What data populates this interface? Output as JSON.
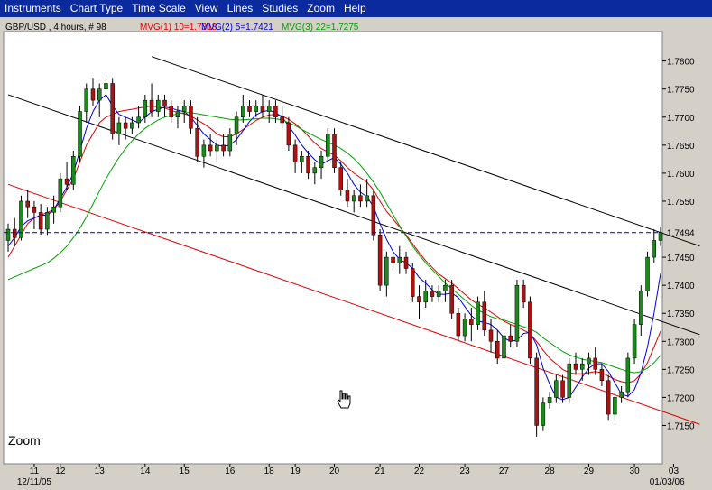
{
  "menu": [
    "Instruments",
    "Chart Type",
    "Time Scale",
    "View",
    "Lines",
    "Studies",
    "Zoom",
    "Help"
  ],
  "chart_header": {
    "instrument": "GBP/USD , 4 hours, # 98",
    "mvg1": "MVG(1) 10=1.7318",
    "mvg2": "MVG(2) 5=1.7421",
    "mvg3": "MVG(3) 22=1.7275"
  },
  "zoom_label": "Zoom",
  "current_price_label": "1.7494",
  "colors": {
    "menubar": "#0a2a9e",
    "up_candle": "#1a8a1a",
    "down_candle": "#b01010",
    "mvg1": "#e00000",
    "mvg2": "#0000dd",
    "mvg3": "#00a000",
    "price_line": "#0000aa"
  },
  "chart_data": {
    "type": "candlestick",
    "title": "GBP/USD , 4 hours, # 98",
    "ylim": [
      1.7125,
      1.783
    ],
    "grid": false,
    "y_ticks": [
      "1.7800",
      "1.7750",
      "1.7700",
      "1.7650",
      "1.7600",
      "1.7550",
      "1.7500",
      "1.7450",
      "1.7400",
      "1.7350",
      "1.7300",
      "1.7250",
      "1.7200",
      "1.7150"
    ],
    "x_ticks": [
      {
        "label": "11",
        "index": 4
      },
      {
        "label": "12",
        "index": 8
      },
      {
        "label": "13",
        "index": 14
      },
      {
        "label": "14",
        "index": 21
      },
      {
        "label": "15",
        "index": 27
      },
      {
        "label": "16",
        "index": 34
      },
      {
        "label": "18",
        "index": 40
      },
      {
        "label": "19",
        "index": 44
      },
      {
        "label": "20",
        "index": 50
      },
      {
        "label": "21",
        "index": 57
      },
      {
        "label": "22",
        "index": 63
      },
      {
        "label": "23",
        "index": 70
      },
      {
        "label": "27",
        "index": 76
      },
      {
        "label": "28",
        "index": 83
      },
      {
        "label": "29",
        "index": 89
      },
      {
        "label": "30",
        "index": 96
      },
      {
        "label": "03",
        "index": 102
      }
    ],
    "x_sublabels": [
      {
        "label": "12/11/05",
        "index": 4
      },
      {
        "label": "01/03/06",
        "index": 101
      }
    ],
    "current_price": 1.7494,
    "candles": [
      [
        1.748,
        1.751,
        1.746,
        1.75
      ],
      [
        1.75,
        1.752,
        1.747,
        1.7485
      ],
      [
        1.7485,
        1.756,
        1.748,
        1.755
      ],
      [
        1.755,
        1.757,
        1.752,
        1.754
      ],
      [
        1.754,
        1.755,
        1.75,
        1.753
      ],
      [
        1.753,
        1.7545,
        1.749,
        1.75
      ],
      [
        1.75,
        1.754,
        1.749,
        1.753
      ],
      [
        1.753,
        1.756,
        1.751,
        1.754
      ],
      [
        1.754,
        1.76,
        1.753,
        1.759
      ],
      [
        1.759,
        1.762,
        1.757,
        1.758
      ],
      [
        1.758,
        1.764,
        1.757,
        1.763
      ],
      [
        1.763,
        1.772,
        1.762,
        1.771
      ],
      [
        1.771,
        1.776,
        1.769,
        1.775
      ],
      [
        1.775,
        1.777,
        1.772,
        1.773
      ],
      [
        1.773,
        1.776,
        1.77,
        1.775
      ],
      [
        1.775,
        1.777,
        1.773,
        1.776
      ],
      [
        1.776,
        1.777,
        1.766,
        1.767
      ],
      [
        1.767,
        1.77,
        1.765,
        1.769
      ],
      [
        1.769,
        1.77,
        1.766,
        1.768
      ],
      [
        1.768,
        1.77,
        1.767,
        1.769
      ],
      [
        1.769,
        1.772,
        1.768,
        1.77
      ],
      [
        1.77,
        1.774,
        1.769,
        1.773
      ],
      [
        1.773,
        1.776,
        1.77,
        1.771
      ],
      [
        1.771,
        1.774,
        1.77,
        1.773
      ],
      [
        1.773,
        1.774,
        1.77,
        1.772
      ],
      [
        1.772,
        1.773,
        1.769,
        1.77
      ],
      [
        1.77,
        1.772,
        1.768,
        1.771
      ],
      [
        1.771,
        1.773,
        1.769,
        1.772
      ],
      [
        1.772,
        1.773,
        1.767,
        1.768
      ],
      [
        1.768,
        1.77,
        1.762,
        1.763
      ],
      [
        1.763,
        1.766,
        1.761,
        1.765
      ],
      [
        1.765,
        1.767,
        1.763,
        1.764
      ],
      [
        1.764,
        1.766,
        1.762,
        1.765
      ],
      [
        1.765,
        1.767,
        1.763,
        1.764
      ],
      [
        1.764,
        1.768,
        1.763,
        1.767
      ],
      [
        1.767,
        1.771,
        1.765,
        1.77
      ],
      [
        1.77,
        1.774,
        1.769,
        1.772
      ],
      [
        1.772,
        1.773,
        1.77,
        1.771
      ],
      [
        1.771,
        1.773,
        1.77,
        1.772
      ],
      [
        1.772,
        1.774,
        1.77,
        1.771
      ],
      [
        1.771,
        1.773,
        1.769,
        1.772
      ],
      [
        1.772,
        1.773,
        1.769,
        1.77
      ],
      [
        1.77,
        1.772,
        1.768,
        1.769
      ],
      [
        1.769,
        1.77,
        1.764,
        1.765
      ],
      [
        1.765,
        1.766,
        1.76,
        1.762
      ],
      [
        1.762,
        1.764,
        1.76,
        1.763
      ],
      [
        1.763,
        1.764,
        1.759,
        1.76
      ],
      [
        1.76,
        1.762,
        1.758,
        1.761
      ],
      [
        1.761,
        1.764,
        1.759,
        1.763
      ],
      [
        1.763,
        1.768,
        1.762,
        1.767
      ],
      [
        1.767,
        1.768,
        1.76,
        1.761
      ],
      [
        1.761,
        1.762,
        1.756,
        1.757
      ],
      [
        1.757,
        1.759,
        1.754,
        1.755
      ],
      [
        1.755,
        1.757,
        1.753,
        1.756
      ],
      [
        1.756,
        1.758,
        1.754,
        1.755
      ],
      [
        1.755,
        1.759,
        1.754,
        1.756
      ],
      [
        1.756,
        1.757,
        1.748,
        1.749
      ],
      [
        1.749,
        1.75,
        1.739,
        1.74
      ],
      [
        1.74,
        1.746,
        1.738,
        1.745
      ],
      [
        1.745,
        1.746,
        1.743,
        1.744
      ],
      [
        1.744,
        1.747,
        1.742,
        1.745
      ],
      [
        1.745,
        1.746,
        1.742,
        1.743
      ],
      [
        1.743,
        1.744,
        1.737,
        1.738
      ],
      [
        1.738,
        1.74,
        1.734,
        1.737
      ],
      [
        1.737,
        1.741,
        1.736,
        1.739
      ],
      [
        1.739,
        1.74,
        1.737,
        1.738
      ],
      [
        1.738,
        1.74,
        1.737,
        1.739
      ],
      [
        1.739,
        1.741,
        1.737,
        1.74
      ],
      [
        1.74,
        1.741,
        1.734,
        1.735
      ],
      [
        1.735,
        1.736,
        1.73,
        1.731
      ],
      [
        1.731,
        1.735,
        1.73,
        1.734
      ],
      [
        1.734,
        1.736,
        1.73,
        1.733
      ],
      [
        1.733,
        1.738,
        1.732,
        1.737
      ],
      [
        1.737,
        1.739,
        1.731,
        1.732
      ],
      [
        1.732,
        1.734,
        1.728,
        1.73
      ],
      [
        1.73,
        1.732,
        1.726,
        1.727
      ],
      [
        1.727,
        1.732,
        1.726,
        1.731
      ],
      [
        1.731,
        1.733,
        1.729,
        1.73
      ],
      [
        1.73,
        1.741,
        1.729,
        1.74
      ],
      [
        1.74,
        1.741,
        1.736,
        1.737
      ],
      [
        1.737,
        1.738,
        1.726,
        1.727
      ],
      [
        1.727,
        1.728,
        1.713,
        1.715
      ],
      [
        1.715,
        1.72,
        1.714,
        1.719
      ],
      [
        1.719,
        1.721,
        1.718,
        1.72
      ],
      [
        1.72,
        1.724,
        1.719,
        1.723
      ],
      [
        1.723,
        1.724,
        1.719,
        1.72
      ],
      [
        1.72,
        1.727,
        1.719,
        1.726
      ],
      [
        1.726,
        1.728,
        1.724,
        1.725
      ],
      [
        1.725,
        1.727,
        1.723,
        1.726
      ],
      [
        1.726,
        1.728,
        1.724,
        1.727
      ],
      [
        1.727,
        1.729,
        1.724,
        1.725
      ],
      [
        1.725,
        1.726,
        1.722,
        1.723
      ],
      [
        1.723,
        1.724,
        1.716,
        1.717
      ],
      [
        1.717,
        1.721,
        1.716,
        1.72
      ],
      [
        1.72,
        1.722,
        1.719,
        1.721
      ],
      [
        1.721,
        1.728,
        1.72,
        1.727
      ],
      [
        1.727,
        1.734,
        1.726,
        1.733
      ],
      [
        1.733,
        1.74,
        1.731,
        1.739
      ],
      [
        1.739,
        1.746,
        1.738,
        1.745
      ],
      [
        1.745,
        1.75,
        1.744,
        1.748
      ],
      [
        1.748,
        1.7505,
        1.747,
        1.7494
      ]
    ],
    "series": [
      {
        "name": "MVG(1) 10",
        "value_label": "1.7318",
        "color": "#e00000",
        "values": [
          1.745,
          1.747,
          1.749,
          1.751,
          1.752,
          1.7525,
          1.753,
          1.7535,
          1.755,
          1.757,
          1.759,
          1.762,
          1.765,
          1.767,
          1.769,
          1.77,
          1.7705,
          1.771,
          1.7712,
          1.7714,
          1.7716,
          1.7718,
          1.772,
          1.7718,
          1.7716,
          1.7712,
          1.7708,
          1.7706,
          1.7702,
          1.7695,
          1.7688,
          1.768,
          1.767,
          1.7665,
          1.7665,
          1.767,
          1.7678,
          1.7686,
          1.7694,
          1.77,
          1.7704,
          1.7705,
          1.7702,
          1.7696,
          1.7688,
          1.7678,
          1.7666,
          1.7654,
          1.7644,
          1.7638,
          1.7632,
          1.7622,
          1.761,
          1.76,
          1.7592,
          1.7584,
          1.757,
          1.755,
          1.7532,
          1.7518,
          1.7504,
          1.749,
          1.7474,
          1.7458,
          1.7444,
          1.7432,
          1.742,
          1.7412,
          1.7404,
          1.7394,
          1.7384,
          1.7374,
          1.7366,
          1.736,
          1.7352,
          1.7344,
          1.7336,
          1.733,
          1.7326,
          1.732,
          1.7314,
          1.73,
          1.7284,
          1.727,
          1.726,
          1.725,
          1.7244,
          1.7242,
          1.7242,
          1.7244,
          1.7246,
          1.7244,
          1.7238,
          1.7232,
          1.7228,
          1.7226,
          1.723,
          1.7242,
          1.7262,
          1.729,
          1.7318
        ]
      },
      {
        "name": "MVG(2) 5",
        "value_label": "1.7421",
        "color": "#0000dd",
        "values": [
          1.747,
          1.7485,
          1.7505,
          1.7515,
          1.752,
          1.7525,
          1.7525,
          1.7535,
          1.7555,
          1.7575,
          1.76,
          1.764,
          1.768,
          1.771,
          1.773,
          1.774,
          1.772,
          1.7705,
          1.77,
          1.7695,
          1.769,
          1.77,
          1.771,
          1.7714,
          1.7718,
          1.7716,
          1.7712,
          1.771,
          1.77,
          1.7685,
          1.767,
          1.766,
          1.765,
          1.7648,
          1.765,
          1.766,
          1.7676,
          1.7692,
          1.7704,
          1.771,
          1.7712,
          1.7708,
          1.77,
          1.7684,
          1.7668,
          1.765,
          1.7636,
          1.7624,
          1.7616,
          1.7622,
          1.7628,
          1.7616,
          1.76,
          1.758,
          1.7566,
          1.7558,
          1.754,
          1.751,
          1.7482,
          1.746,
          1.7446,
          1.744,
          1.743,
          1.7414,
          1.7404,
          1.7392,
          1.7384,
          1.7384,
          1.7386,
          1.7378,
          1.7362,
          1.7346,
          1.7336,
          1.7334,
          1.733,
          1.732,
          1.7306,
          1.73,
          1.7302,
          1.7314,
          1.7316,
          1.7294,
          1.7252,
          1.7224,
          1.72,
          1.7196,
          1.72,
          1.7218,
          1.7236,
          1.7252,
          1.726,
          1.726,
          1.7246,
          1.7226,
          1.7206,
          1.7202,
          1.7214,
          1.7244,
          1.729,
          1.735,
          1.7421
        ]
      },
      {
        "name": "MVG(3) 22",
        "value_label": "1.7275",
        "color": "#00a000",
        "values": [
          1.741,
          1.7415,
          1.742,
          1.7425,
          1.743,
          1.7435,
          1.744,
          1.7448,
          1.7458,
          1.747,
          1.7485,
          1.7502,
          1.7522,
          1.7545,
          1.7568,
          1.759,
          1.761,
          1.7628,
          1.7644,
          1.7658,
          1.767,
          1.768,
          1.7688,
          1.7695,
          1.77,
          1.7703,
          1.7706,
          1.7708,
          1.7708,
          1.7706,
          1.7704,
          1.7702,
          1.77,
          1.7698,
          1.7696,
          1.7695,
          1.7695,
          1.7696,
          1.7697,
          1.7698,
          1.7698,
          1.7697,
          1.7695,
          1.769,
          1.7685,
          1.7678,
          1.7672,
          1.7666,
          1.766,
          1.7655,
          1.765,
          1.7644,
          1.7636,
          1.7626,
          1.7614,
          1.76,
          1.7584,
          1.7566,
          1.7546,
          1.7526,
          1.7506,
          1.7488,
          1.747,
          1.7454,
          1.744,
          1.7428,
          1.7416,
          1.7404,
          1.7394,
          1.7384,
          1.7374,
          1.7364,
          1.7356,
          1.735,
          1.7344,
          1.734,
          1.7338,
          1.7334,
          1.733,
          1.7326,
          1.7322,
          1.7316,
          1.7306,
          1.7298,
          1.729,
          1.7282,
          1.7276,
          1.7272,
          1.7268,
          1.7266,
          1.7264,
          1.7262,
          1.7258,
          1.7254,
          1.725,
          1.7246,
          1.7244,
          1.7246,
          1.7252,
          1.7262,
          1.7275
        ]
      }
    ],
    "trendlines": [
      {
        "name": "upper-channel-line",
        "color": "#000000",
        "from": [
          22,
          1.7808
        ],
        "to": [
          106,
          1.747
        ]
      },
      {
        "name": "middle-channel-line",
        "color": "#000000",
        "from": [
          0,
          1.774
        ],
        "to": [
          106,
          1.7312
        ]
      },
      {
        "name": "lower-channel-line",
        "color": "#e00000",
        "from": [
          0,
          1.758
        ],
        "to": [
          106,
          1.7152
        ]
      }
    ]
  }
}
